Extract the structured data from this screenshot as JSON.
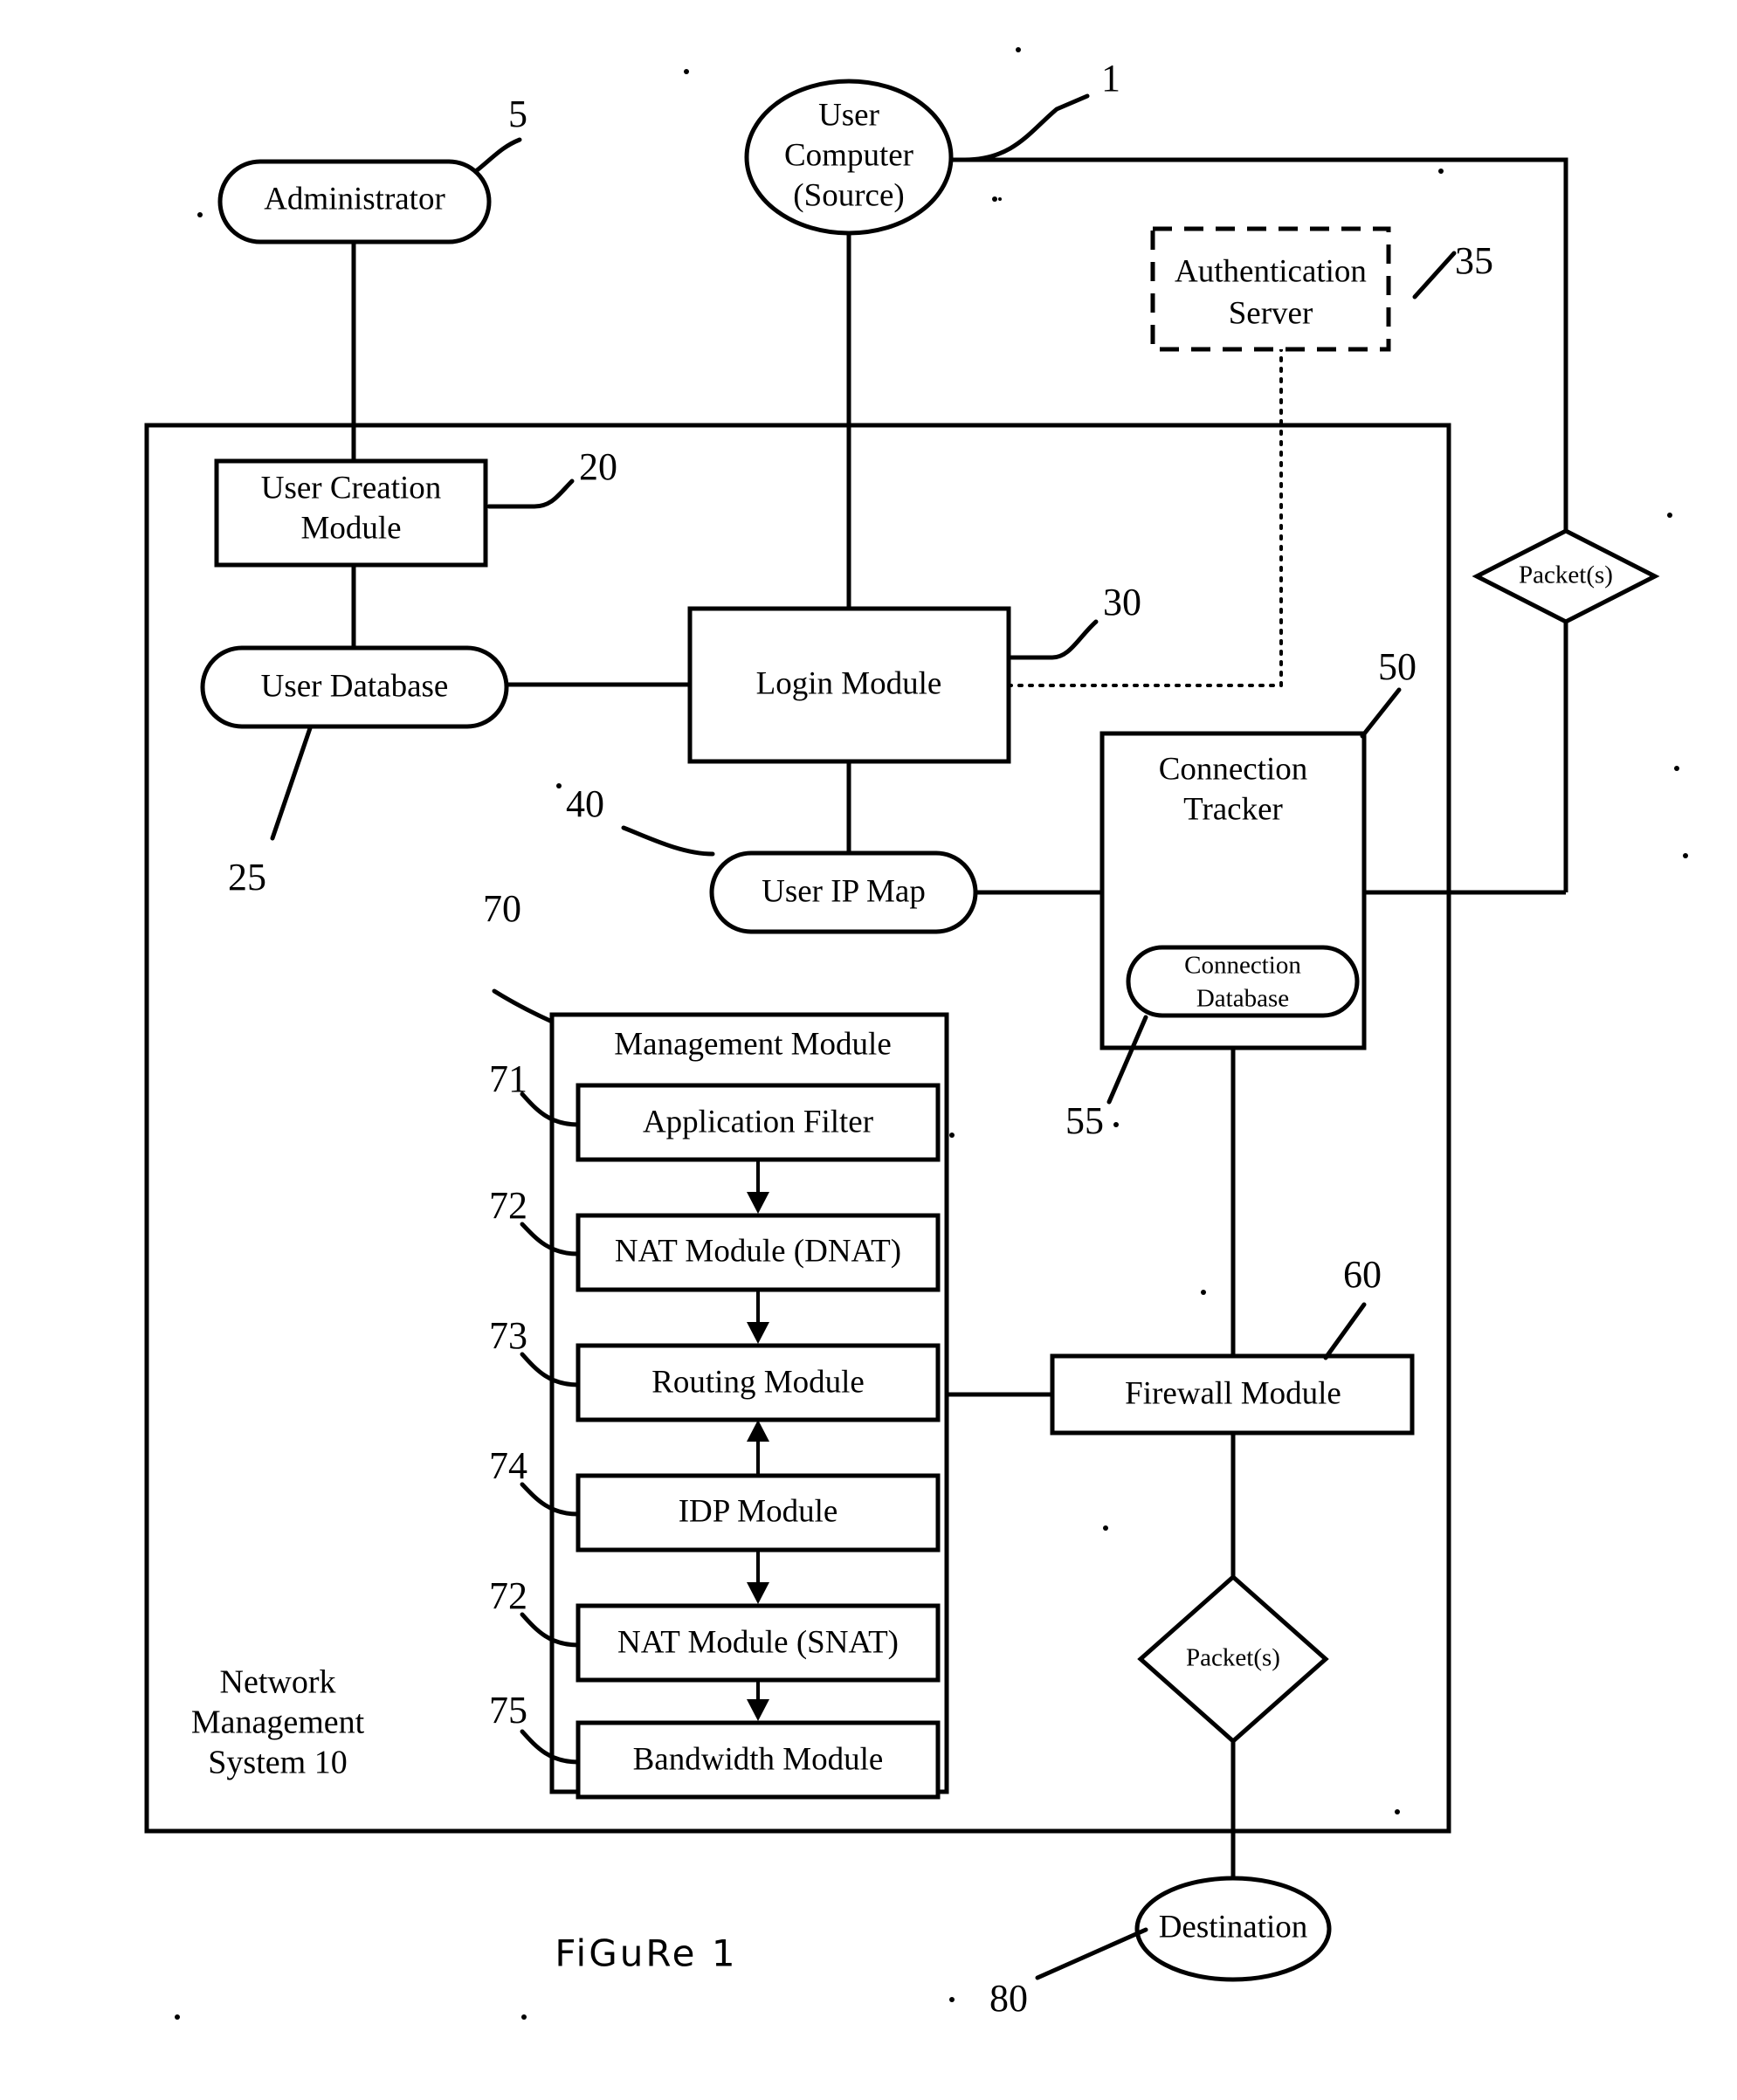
{
  "figure": {
    "caption": "FiGuRe 1"
  },
  "system": {
    "name_line1": "Network",
    "name_line2": "Management",
    "name_line3": "System 10"
  },
  "nodes": {
    "user_computer": {
      "line1": "User",
      "line2": "Computer",
      "line3": "(Source)",
      "ref": "1"
    },
    "administrator": {
      "label": "Administrator",
      "ref": "5"
    },
    "user_creation_module": {
      "line1": "User Creation",
      "line2": "Module",
      "ref": "20"
    },
    "user_database": {
      "label": "User Database",
      "ref": "25"
    },
    "login_module": {
      "label": "Login Module",
      "ref": "30"
    },
    "authentication_server": {
      "line1": "Authentication",
      "line2": "Server",
      "ref": "35"
    },
    "user_ip_map": {
      "label": "User IP Map",
      "ref": "40"
    },
    "connection_tracker": {
      "line1": "Connection",
      "line2": "Tracker",
      "ref": "50"
    },
    "connection_database": {
      "line1": "Connection",
      "line2": "Database",
      "ref": "55"
    },
    "firewall_module": {
      "label": "Firewall Module",
      "ref": "60"
    },
    "management_module": {
      "label": "Management Module",
      "ref": "70"
    },
    "application_filter": {
      "label": "Application Filter",
      "ref": "71"
    },
    "nat_module_dnat": {
      "label": "NAT Module (DNAT)",
      "ref": "72"
    },
    "routing_module": {
      "label": "Routing Module",
      "ref": "73"
    },
    "idp_module": {
      "label": "IDP Module",
      "ref": "74"
    },
    "nat_module_snat": {
      "label": "NAT Module (SNAT)",
      "ref": "72"
    },
    "bandwidth_module": {
      "label": "Bandwidth Module",
      "ref": "75"
    },
    "packet_right": {
      "label": "Packet(s)"
    },
    "packet_bottom": {
      "label": "Packet(s)"
    },
    "destination": {
      "label": "Destination",
      "ref": "80"
    }
  }
}
